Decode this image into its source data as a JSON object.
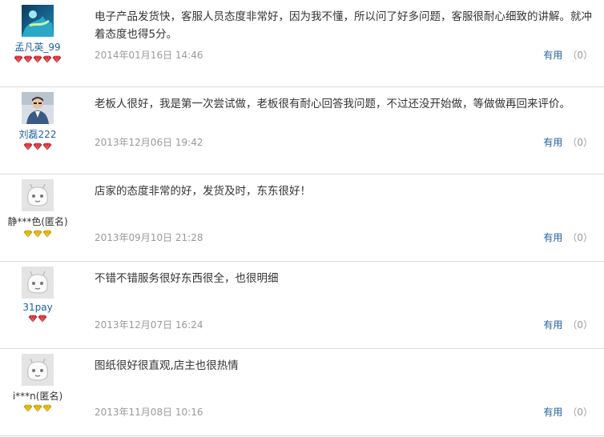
{
  "colors": {
    "link": "#1f5f9f",
    "date": "#9a9a9a",
    "red_badge": "#e0393d",
    "gold_badge": "#e8b800"
  },
  "reviews": [
    {
      "user": "孟凡英_99",
      "user_style": "link",
      "avatar": "landscape-avatar",
      "badge_type": "red",
      "badge_count": 5,
      "text": "电子产品发货快，客服人员态度非常好，因为我不懂，所以问了好多问题，客服很耐心细致的讲解。就冲着态度也得5分。",
      "date": "2014年01月16日 14:46",
      "useful_label": "有用",
      "useful_count": "（0）"
    },
    {
      "user": "刘磊222",
      "user_style": "link",
      "avatar": "person-avatar",
      "badge_type": "red",
      "badge_count": 3,
      "text": "老板人很好，我是第一次尝试做，老板很有耐心回答我问题，不过还没开始做，等做做再回来评价。",
      "date": "2013年12月06日 19:42",
      "useful_label": "有用",
      "useful_count": "（0）"
    },
    {
      "user": "静***色(匿名)",
      "user_style": "anon",
      "avatar": "default-avatar",
      "badge_type": "gold",
      "badge_count": 3,
      "text": "店家的态度非常的好，发货及时，东东很好！",
      "date": "2013年09月10日 21:28",
      "useful_label": "有用",
      "useful_count": "（0）"
    },
    {
      "user": "31pay",
      "user_style": "link",
      "avatar": "default-avatar",
      "badge_type": "red",
      "badge_count": 2,
      "text": "不错不错服务很好东西很全，也很明细",
      "date": "2013年12月07日 16:24",
      "useful_label": "有用",
      "useful_count": "（0）"
    },
    {
      "user": "i***n(匿名)",
      "user_style": "anon",
      "avatar": "default-avatar",
      "badge_type": "gold",
      "badge_count": 3,
      "text": "图纸很好很直观,店主也很热情",
      "date": "2013年11月08日 10:16",
      "useful_label": "有用",
      "useful_count": "（0）"
    }
  ]
}
